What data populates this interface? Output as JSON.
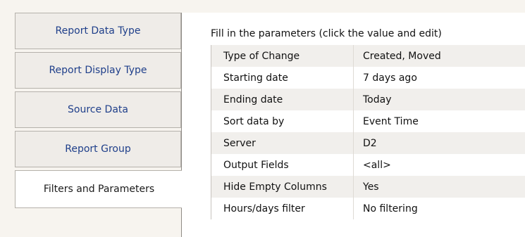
{
  "tabs": [
    {
      "label": "Report Data Type"
    },
    {
      "label": "Report Display Type"
    },
    {
      "label": "Source Data"
    },
    {
      "label": "Report Group"
    },
    {
      "label": "Filters and Parameters"
    }
  ],
  "panel": {
    "heading": "Fill in the parameters (click the value and edit)",
    "params": [
      {
        "name": "Type of Change",
        "value": "Created, Moved"
      },
      {
        "name": "Starting date",
        "value": "7 days ago"
      },
      {
        "name": "Ending date",
        "value": "Today"
      },
      {
        "name": "Sort data by",
        "value": "Event Time"
      },
      {
        "name": "Server",
        "value": "D2"
      },
      {
        "name": "Output Fields",
        "value": "<all>"
      },
      {
        "name": "Hide Empty Columns",
        "value": "Yes"
      },
      {
        "name": "Hours/days filter",
        "value": "No filtering"
      }
    ]
  }
}
